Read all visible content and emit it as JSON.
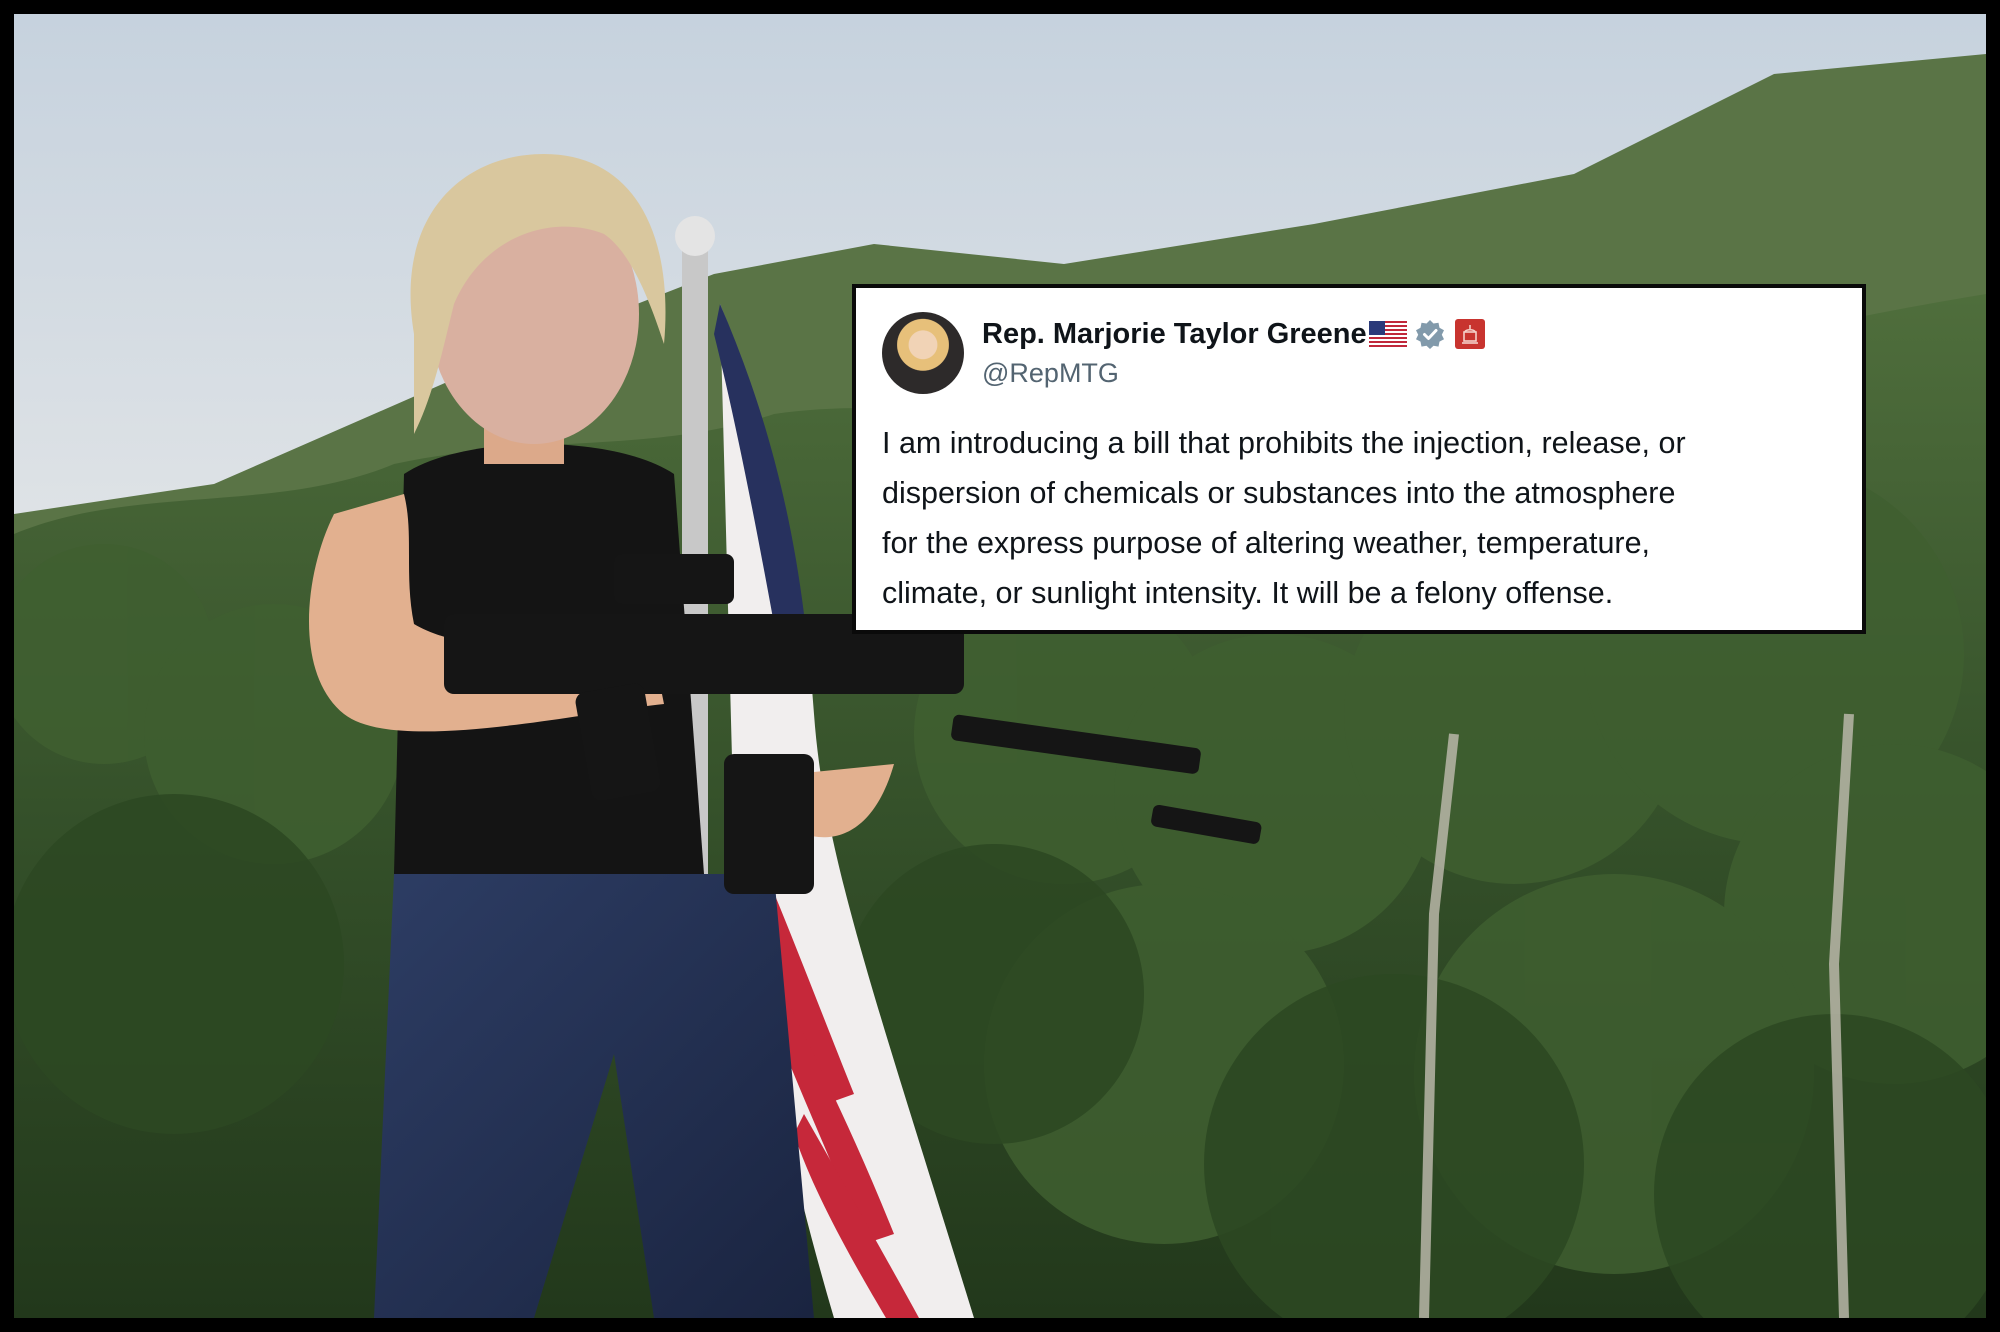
{
  "tweet": {
    "display_name": "Rep. Marjorie Taylor Greene",
    "handle": "@RepMTG",
    "body_lines": [
      "I am introducing a bill that prohibits the injection, release, or",
      "dispersion of chemicals or substances into the atmosphere",
      "for the express purpose of altering weather, temperature,",
      "climate, or sunlight intensity. It will be a felony offense."
    ],
    "icons": {
      "flag": "us-flag-icon",
      "verified": "verified-badge-icon",
      "affiliation": "government-affiliation-icon"
    }
  },
  "colors": {
    "text_primary": "#0f1419",
    "text_secondary": "#536471",
    "verified_badge": "#829aab",
    "affiliation_badge": "#c8342f",
    "frame": "#000000"
  }
}
